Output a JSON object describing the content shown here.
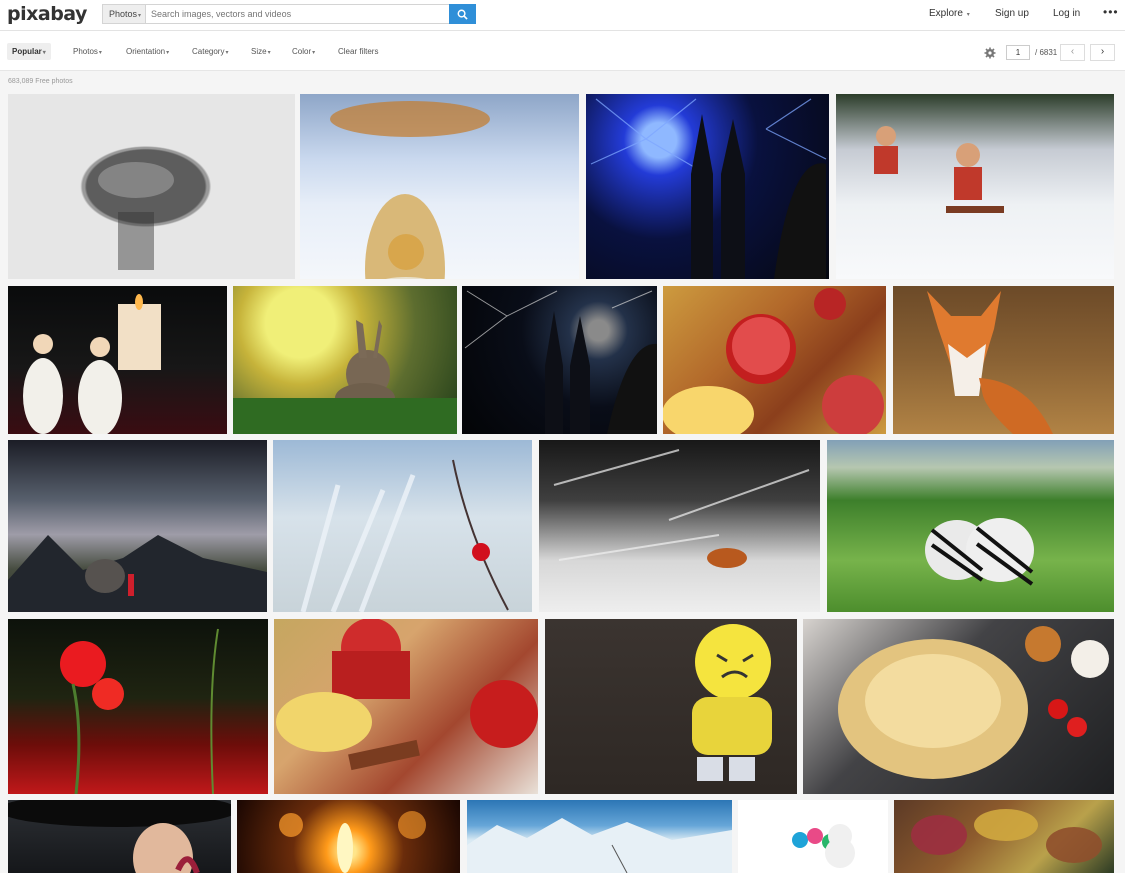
{
  "header": {
    "logo": "pixabay",
    "search_type": "Photos",
    "search_placeholder": "Search images, vectors and videos",
    "explore": "Explore",
    "signup": "Sign up",
    "login": "Log in",
    "more": "•••"
  },
  "filters": {
    "popular": "Popular",
    "photos": "Photos",
    "orientation": "Orientation",
    "category": "Category",
    "size": "Size",
    "color": "Color",
    "clear": "Clear filters"
  },
  "pagination": {
    "current": "1",
    "total": "/ 6831",
    "prev": "‹",
    "next": "›"
  },
  "result_count": "683,089 Free photos",
  "photos": [
    {
      "subject": "cracked stone head"
    },
    {
      "subject": "angel figurine in snow"
    },
    {
      "subject": "fireworks over cathedral"
    },
    {
      "subject": "figurines on sled in snow"
    },
    {
      "subject": "angel figurines with candle"
    },
    {
      "subject": "rabbit in meadow"
    },
    {
      "subject": "fireworks cathedral bridge"
    },
    {
      "subject": "baked apples"
    },
    {
      "subject": "red fox"
    },
    {
      "subject": "elephant and girl under storm"
    },
    {
      "subject": "cardinal in frosty reeds"
    },
    {
      "subject": "fox in snowy forest"
    },
    {
      "subject": "zebras in grass"
    },
    {
      "subject": "red poppies"
    },
    {
      "subject": "baked apples with vanilla sauce"
    },
    {
      "subject": "yellow angry plush"
    },
    {
      "subject": "raw chicken with vegetables"
    },
    {
      "subject": "woman with black hat"
    },
    {
      "subject": "candle light"
    },
    {
      "subject": "frozen lake mountains"
    },
    {
      "subject": "snowman figurine"
    },
    {
      "subject": "autumn leaves"
    }
  ]
}
